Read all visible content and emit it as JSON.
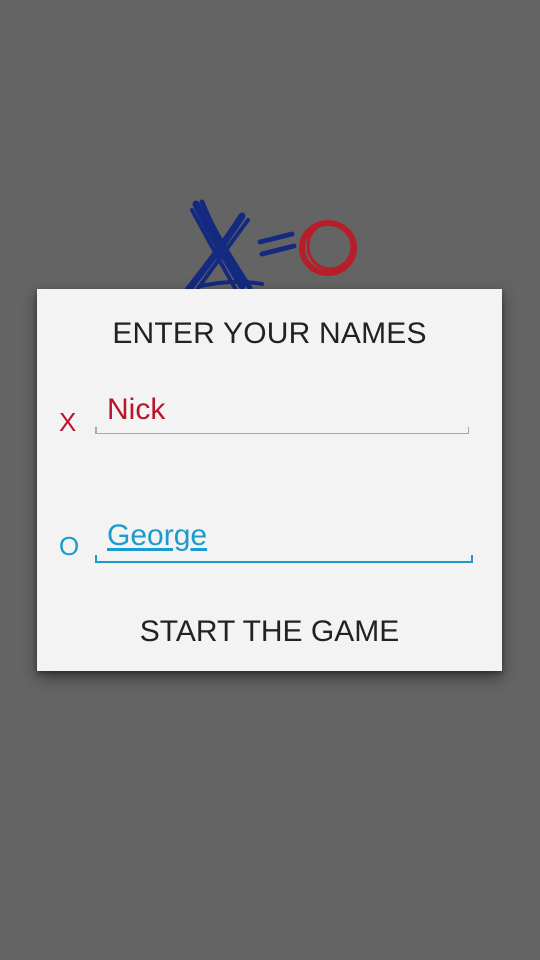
{
  "dialog": {
    "title": "ENTER YOUR NAMES",
    "player_x": {
      "symbol": "X",
      "name": "Nick",
      "color": "#b8152c"
    },
    "player_o": {
      "symbol": "O",
      "name": "George",
      "color": "#1a9ccc"
    },
    "start_button": "START THE GAME"
  },
  "logo": {
    "icon": "x-equals-o-logo",
    "colors": {
      "x": "#142a80",
      "o": "#b81e2a"
    }
  },
  "background_color": "#646464"
}
